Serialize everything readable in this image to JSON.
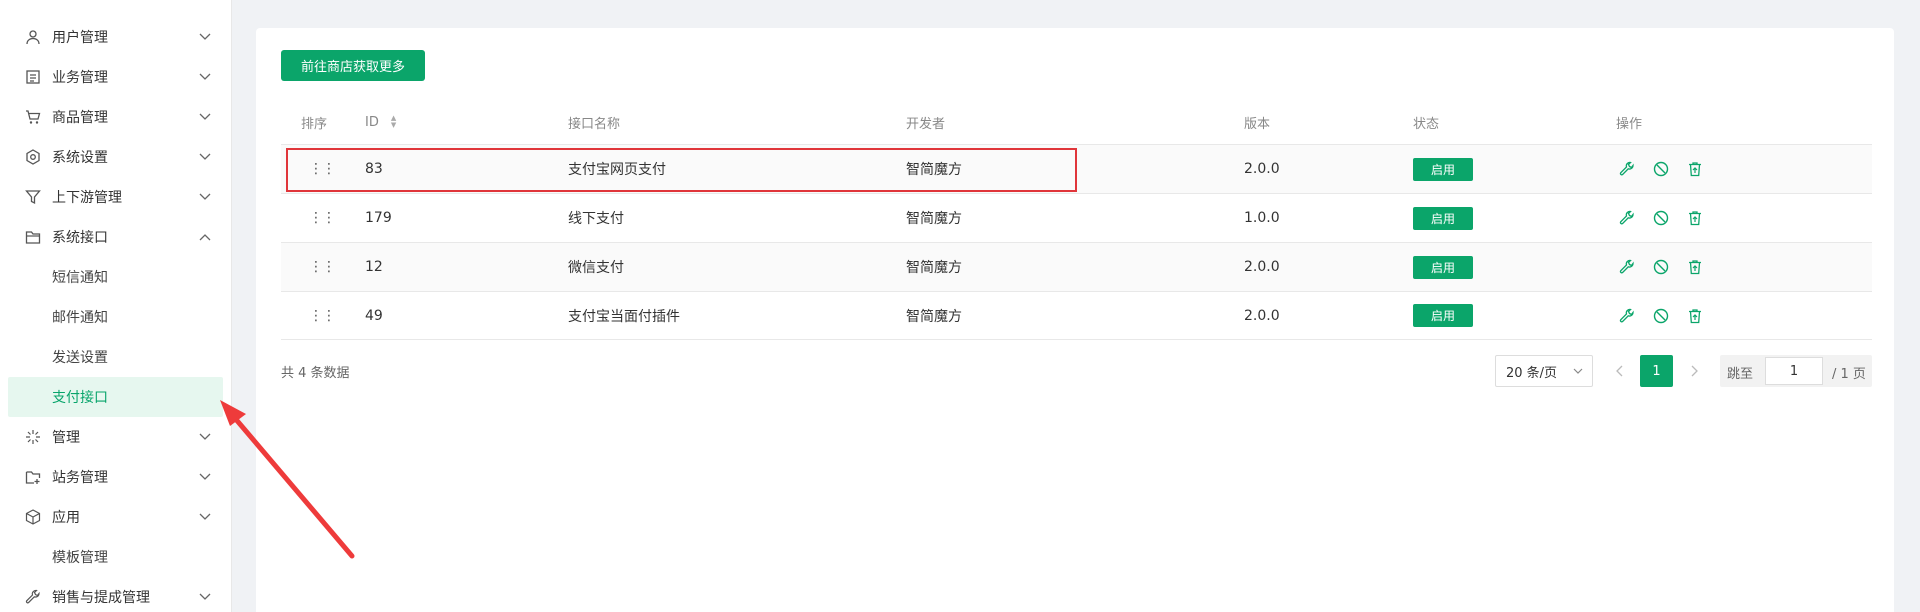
{
  "sidebar": {
    "items": [
      {
        "label": "用户管理",
        "icon": "user-icon",
        "expanded": false
      },
      {
        "label": "业务管理",
        "icon": "document-list-icon",
        "expanded": false
      },
      {
        "label": "商品管理",
        "icon": "cart-icon",
        "expanded": false
      },
      {
        "label": "系统设置",
        "icon": "gear-hex-icon",
        "expanded": false
      },
      {
        "label": "上下游管理",
        "icon": "filter-icon",
        "expanded": false
      },
      {
        "label": "系统接口",
        "icon": "folder-icon",
        "expanded": true
      },
      {
        "label": "管理",
        "icon": "sparkle-icon",
        "expanded": false
      },
      {
        "label": "站务管理",
        "icon": "folder-add-icon",
        "expanded": false
      },
      {
        "label": "应用",
        "icon": "cube-icon",
        "expanded": false
      },
      {
        "label": "销售与提成管理",
        "icon": "wrench-icon",
        "expanded": false
      }
    ],
    "sub_items": [
      "短信通知",
      "邮件通知",
      "发送设置",
      "支付接口",
      "模板管理"
    ],
    "active_sub_item": "支付接口"
  },
  "toolbar": {
    "store_button_label": "前往商店获取更多"
  },
  "table": {
    "headers": [
      "排序",
      "ID",
      "接口名称",
      "开发者",
      "版本",
      "状态",
      "操作"
    ],
    "rows": [
      {
        "id": "83",
        "name": "支付宝网页支付",
        "developer": "智简魔方",
        "version": "2.0.0",
        "status": "启用"
      },
      {
        "id": "179",
        "name": "线下支付",
        "developer": "智简魔方",
        "version": "1.0.0",
        "status": "启用"
      },
      {
        "id": "12",
        "name": "微信支付",
        "developer": "智简魔方",
        "version": "2.0.0",
        "status": "启用"
      },
      {
        "id": "49",
        "name": "支付宝当面付插件",
        "developer": "智简魔方",
        "version": "2.0.0",
        "status": "启用"
      }
    ],
    "row_actions": [
      "wrench-icon",
      "disable-circle-icon",
      "delete-icon"
    ]
  },
  "pagination": {
    "total_text": "共 4 条数据",
    "page_size": "20 条/页",
    "current_page": "1",
    "jump_label": "跳至",
    "jump_value": "1",
    "total_pages": "/ 1 页"
  },
  "colors": {
    "accent": "#0ba56a",
    "highlight": "#e0353a",
    "active_bg": "#e6f7ef"
  }
}
